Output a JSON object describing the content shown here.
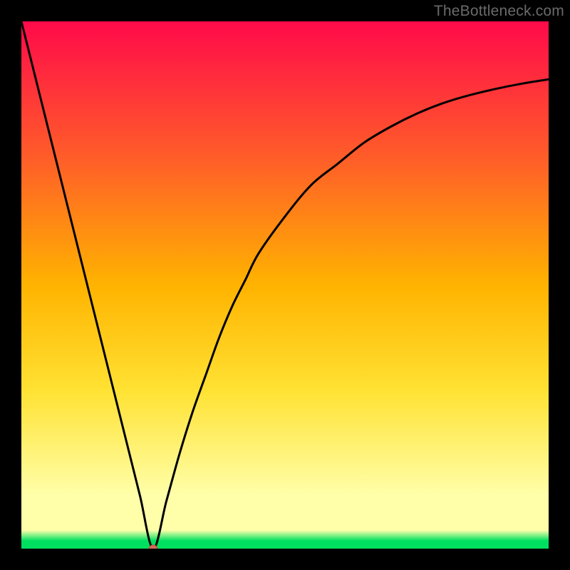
{
  "watermark": "TheBottleneck.com",
  "colors": {
    "black": "#000000",
    "curve": "#000000",
    "marker_fill": "#d56a5a",
    "marker_stroke": "#b84c3b",
    "grad_top": "#ff0a4a",
    "grad_mid1": "#ff5a2a",
    "grad_mid2": "#ffb300",
    "grad_mid3": "#ffe233",
    "grad_pale": "#ffffaa",
    "grad_green": "#00e060"
  },
  "chart_data": {
    "type": "line",
    "title": "",
    "xlabel": "",
    "ylabel": "",
    "xlim": [
      0,
      100
    ],
    "ylim": [
      0,
      100
    ],
    "curve": {
      "x": [
        0,
        2.5,
        5,
        7.5,
        10,
        12.5,
        15,
        17.5,
        20,
        22.5,
        25,
        27.5,
        30,
        32.5,
        35,
        37.5,
        40,
        42.5,
        45,
        50,
        55,
        60,
        65,
        70,
        75,
        80,
        85,
        90,
        95,
        100
      ],
      "y": [
        100,
        90,
        80,
        70,
        60,
        50,
        40,
        30,
        20,
        10,
        0,
        9,
        18,
        26,
        33,
        40,
        46,
        51,
        56,
        63,
        69,
        73,
        77,
        80,
        82.5,
        84.5,
        86,
        87.2,
        88.2,
        89
      ]
    },
    "min_marker": {
      "x": 25,
      "y": 0
    },
    "gradient_stops": [
      {
        "offset": 0.0,
        "color_key": "grad_top"
      },
      {
        "offset": 0.25,
        "color_key": "grad_mid1"
      },
      {
        "offset": 0.5,
        "color_key": "grad_mid2"
      },
      {
        "offset": 0.7,
        "color_key": "grad_mid3"
      },
      {
        "offset": 0.9,
        "color_key": "grad_pale"
      },
      {
        "offset": 0.965,
        "color_key": "grad_pale"
      },
      {
        "offset": 0.985,
        "color_key": "grad_green"
      },
      {
        "offset": 1.0,
        "color_key": "grad_green"
      }
    ]
  }
}
